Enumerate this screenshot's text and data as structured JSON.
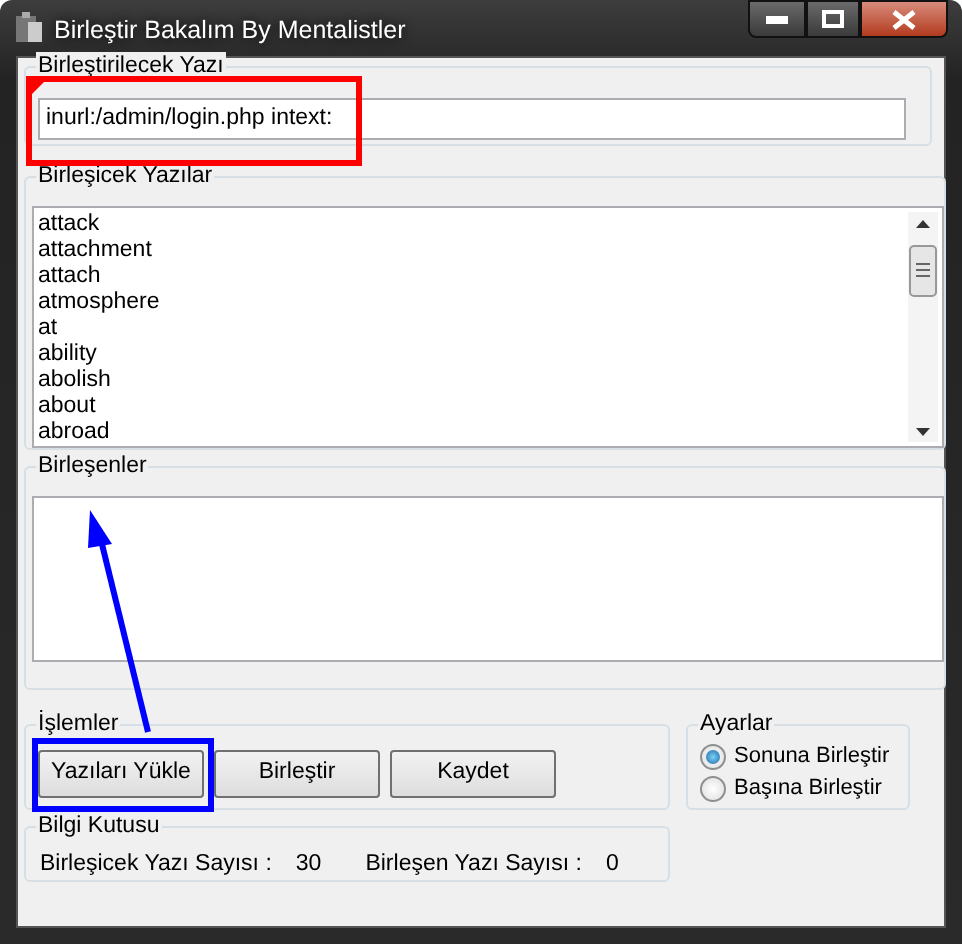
{
  "window": {
    "title": "Birleştir Bakalım By Mentalistler"
  },
  "source_group": {
    "label": "Birleştirilecek Yazı",
    "value": "inurl:/admin/login.php intext:"
  },
  "words_group": {
    "label": "Birleşicek Yazılar",
    "items": [
      "attack",
      "attachment",
      "attach",
      "atmosphere",
      "at",
      "ability",
      "abolish",
      "about",
      "abroad"
    ]
  },
  "result_group": {
    "label": "Birleşenler"
  },
  "actions_group": {
    "label": "İşlemler",
    "buttons": [
      "Yazıları Yükle",
      "Birleştir",
      "Kaydet"
    ]
  },
  "settings_group": {
    "label": "Ayarlar",
    "options": [
      {
        "label": "Sonuna Birleştir",
        "selected": true
      },
      {
        "label": "Başına Birleştir",
        "selected": false
      }
    ]
  },
  "info_group": {
    "label": "Bilgi Kutusu",
    "stats": [
      {
        "label": "Birleşicek Yazı Sayısı :",
        "value": "30"
      },
      {
        "label": "Birleşen Yazı Sayısı :",
        "value": "0"
      }
    ]
  }
}
